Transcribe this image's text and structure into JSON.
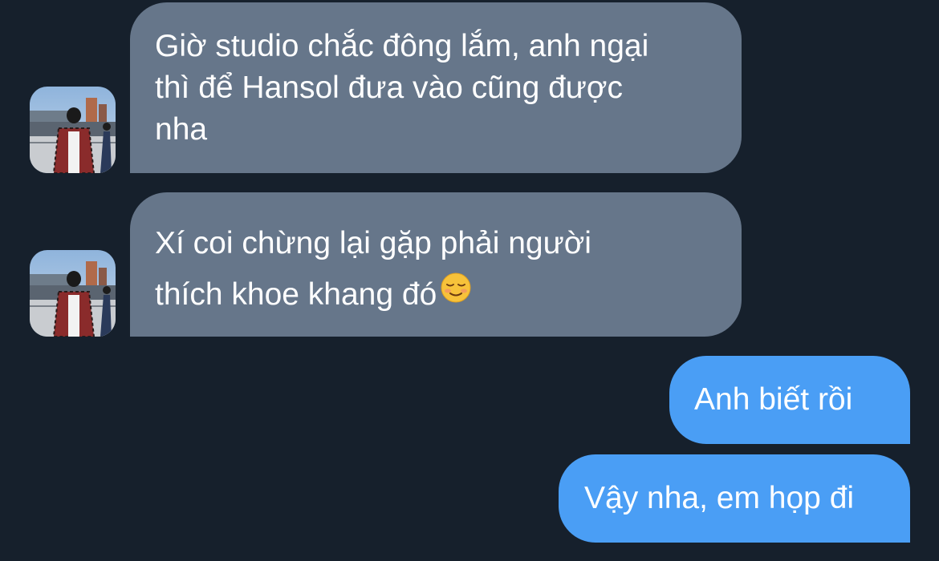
{
  "messages": [
    {
      "sender": "other",
      "lines": [
        "Giờ studio chắc đông lắm, anh ngại",
        "thì để Hansol đưa vào cũng được",
        "nha"
      ]
    },
    {
      "sender": "other",
      "lines": [
        "Xí coi chừng lại gặp phải người",
        "thích khoe khang đó"
      ],
      "emoji": "relieved-face"
    },
    {
      "sender": "me",
      "lines": [
        "Anh biết rồi"
      ]
    },
    {
      "sender": "me",
      "lines": [
        "Vậy nha, em họp đi"
      ]
    }
  ],
  "colors": {
    "background": "#16202c",
    "incoming_bubble": "#66768a",
    "outgoing_bubble": "#4a9ef5",
    "text": "#ffffff"
  }
}
